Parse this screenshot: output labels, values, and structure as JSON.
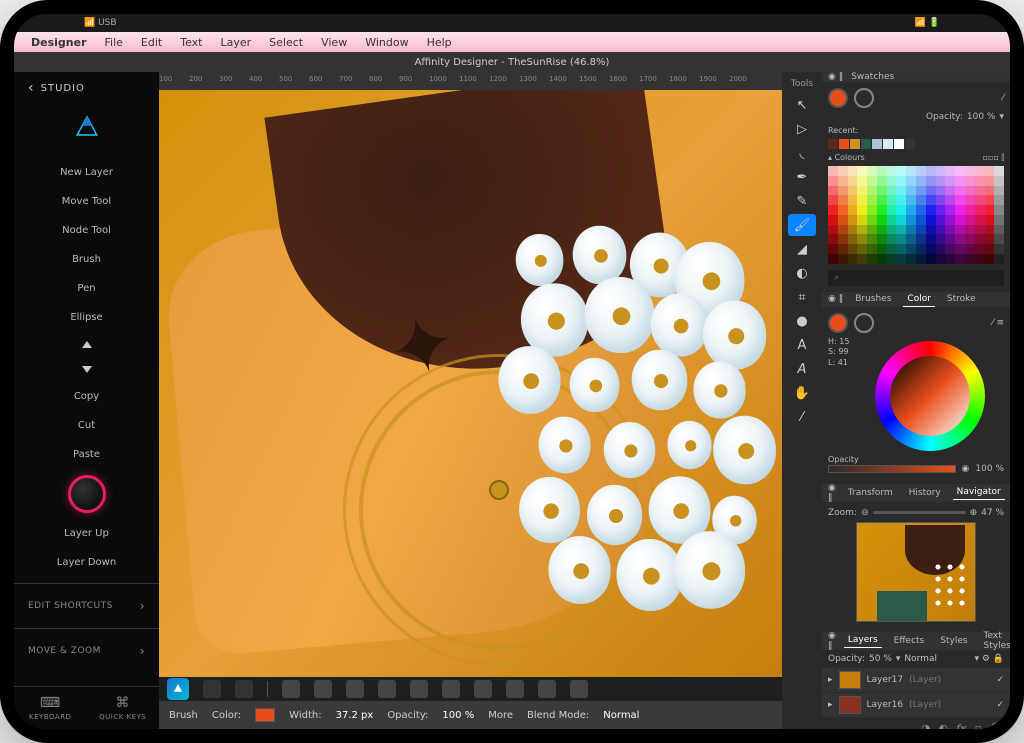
{
  "statusbar": {
    "usb": "USB"
  },
  "menubar": {
    "app": "Designer",
    "items": [
      "File",
      "Edit",
      "Text",
      "Layer",
      "Select",
      "View",
      "Window",
      "Help"
    ]
  },
  "titlebar": "Affinity Designer - TheSunRise (46.8%)",
  "sidebar": {
    "header": "STUDIO",
    "items": [
      "New Layer",
      "Move Tool",
      "Node Tool",
      "Brush",
      "Pen",
      "Ellipse"
    ],
    "clipboard": [
      "Copy",
      "Cut",
      "Paste"
    ],
    "layer": [
      "Layer Up",
      "Layer Down"
    ],
    "shortcuts": "EDIT SHORTCUTS",
    "movezoom": "MOVE & ZOOM",
    "foot": [
      "KEYBOARD",
      "QUICK KEYS"
    ]
  },
  "ruler": [
    "100",
    "200",
    "300",
    "400",
    "500",
    "600",
    "700",
    "800",
    "900",
    "1000",
    "1100",
    "1200",
    "1300",
    "1400",
    "1500",
    "1600",
    "1700",
    "1800",
    "1900",
    "2000"
  ],
  "context": {
    "brush": "Brush",
    "color": "Color:",
    "width_l": "Width:",
    "width": "37.2 px",
    "opacity_l": "Opacity:",
    "opacity": "100 %",
    "more": "More",
    "blend_l": "Blend Mode:",
    "blend": "Normal"
  },
  "tools_hdr": "Tools",
  "swatches": {
    "tab": "Swatches",
    "opacity_l": "Opacity:",
    "opacity": "100 %",
    "recent_l": "Recent:",
    "colours": "Colours"
  },
  "colorpanel": {
    "tabs": [
      "Brushes",
      "Color",
      "Stroke"
    ],
    "active": "Color",
    "h": "H: 15",
    "s": "S: 99",
    "l": "L: 41",
    "opacity_l": "Opacity",
    "opacity": "100 %"
  },
  "nav": {
    "tabs": [
      "Transform",
      "History",
      "Navigator"
    ],
    "active": "Navigator",
    "zoom_l": "Zoom:",
    "zoom": "47 %"
  },
  "layers": {
    "tabs": [
      "Layers",
      "Effects",
      "Styles",
      "Text Styles"
    ],
    "active": "Layers",
    "opacity_l": "Opacity:",
    "opacity": "50 %",
    "blend": "Normal",
    "items": [
      {
        "name": "Layer17",
        "type": "(Layer)"
      },
      {
        "name": "Layer16",
        "type": "(Layer)"
      }
    ]
  },
  "recent_colors": [
    "#5a2a18",
    "#e84e1c",
    "#c9921f",
    "#2a5a4a",
    "#a8c4d0",
    "#d9e8ee",
    "#ffffff",
    "#333333"
  ],
  "accent": "#e84e1c"
}
